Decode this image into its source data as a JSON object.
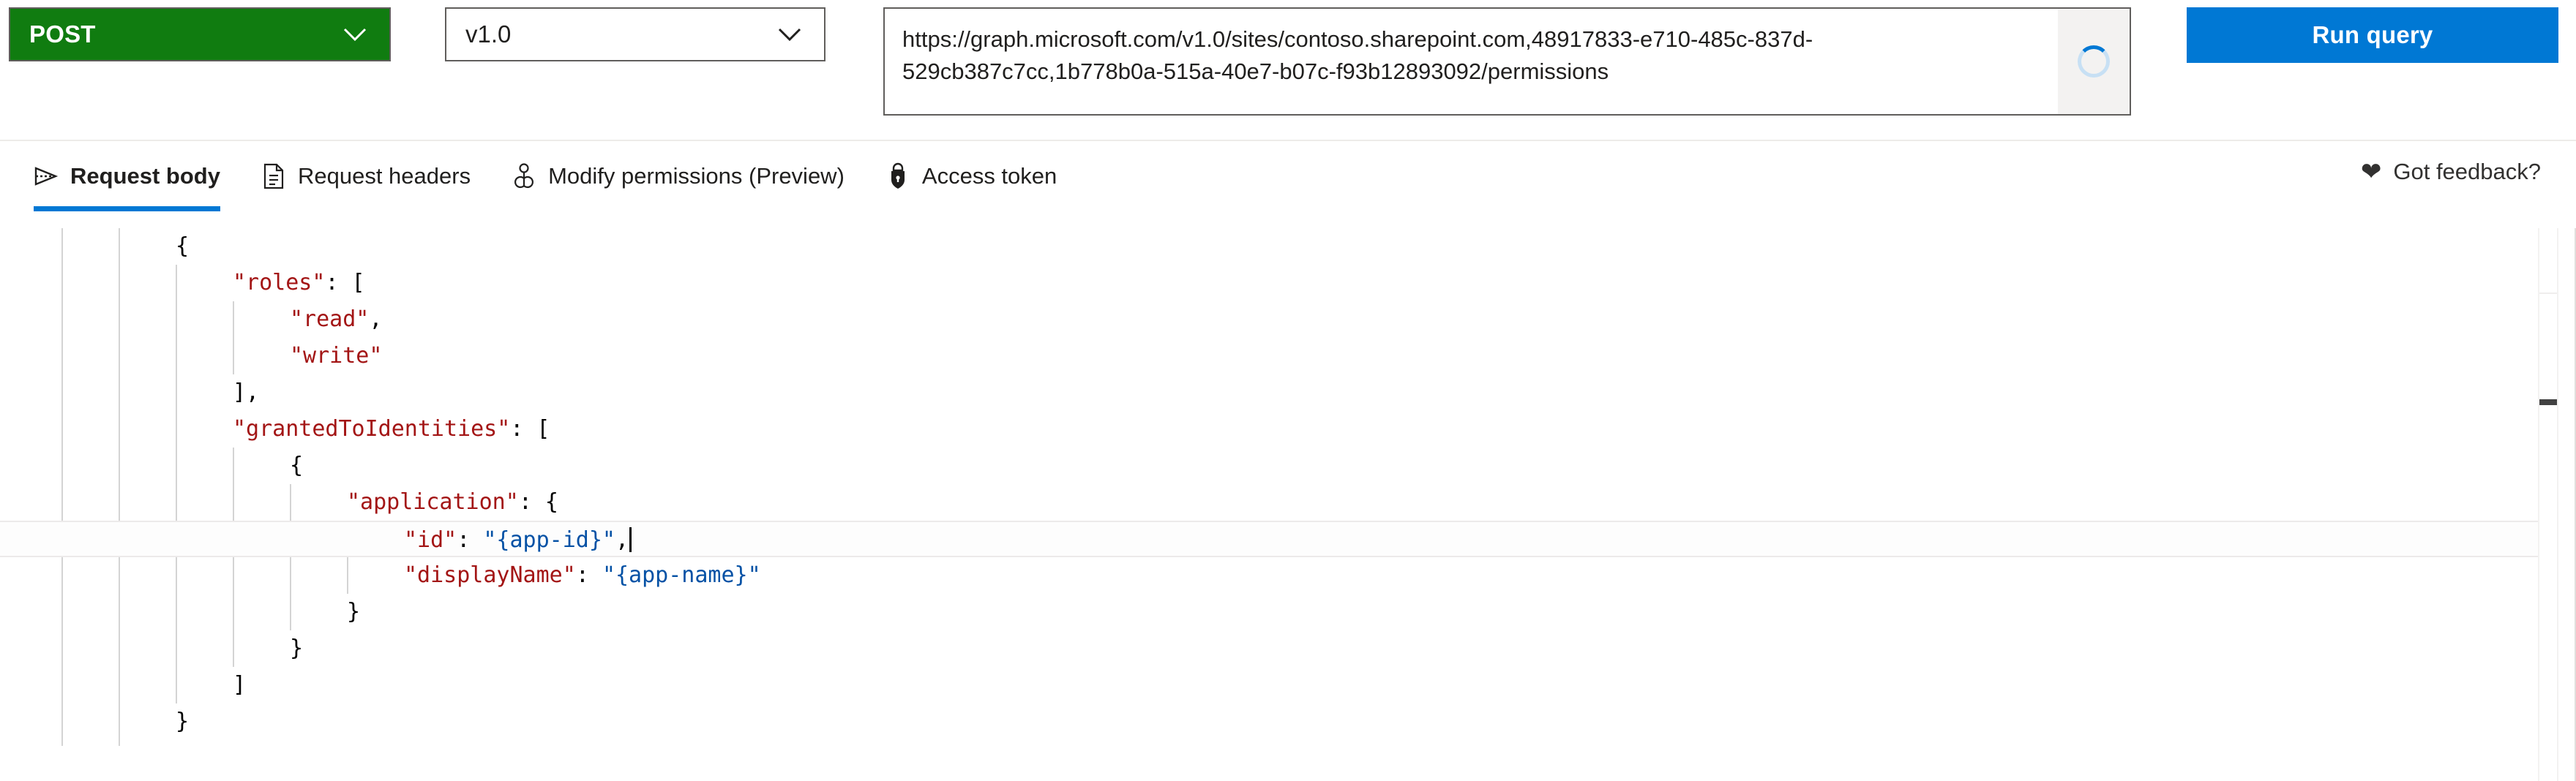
{
  "query_bar": {
    "method": {
      "value": "POST",
      "chevron_icon": "chevron-down-icon",
      "background": "#107c10"
    },
    "version": {
      "value": "v1.0",
      "chevron_icon": "chevron-down-icon"
    },
    "url": {
      "value": "https://graph.microsoft.com/v1.0/sites/contoso.sharepoint.com,48917833-e710-485c-837d-529cb387c7cc,1b778b0a-515a-40e7-b07c-f93b12893092/permissions",
      "loading_icon": "spinner-icon"
    },
    "run_query": {
      "label": "Run query",
      "background": "#0078d4"
    }
  },
  "tabs": {
    "accent_color": "#0078d4",
    "items": [
      {
        "label": "Request body",
        "icon": "send-arrow-icon",
        "active": true
      },
      {
        "label": "Request headers",
        "icon": "document-list-icon",
        "active": false
      },
      {
        "label": "Modify permissions (Preview)",
        "icon": "key-icon",
        "active": false
      },
      {
        "label": "Access token",
        "icon": "lock-shield-icon",
        "active": false
      }
    ],
    "feedback": {
      "label": "Got feedback?",
      "icon": "heart-icon"
    }
  },
  "editor": {
    "language": "json",
    "cursor_line": 7,
    "lines": [
      {
        "indent": 0,
        "tokens": [
          {
            "t": "{",
            "c": "punct"
          }
        ]
      },
      {
        "indent": 1,
        "tokens": [
          {
            "t": "\"roles\"",
            "c": "key"
          },
          {
            "t": ": [",
            "c": "punct"
          }
        ]
      },
      {
        "indent": 2,
        "tokens": [
          {
            "t": "\"read\"",
            "c": "key"
          },
          {
            "t": ",",
            "c": "punct"
          }
        ]
      },
      {
        "indent": 2,
        "tokens": [
          {
            "t": "\"write\"",
            "c": "key"
          }
        ]
      },
      {
        "indent": 1,
        "tokens": [
          {
            "t": "],",
            "c": "punct"
          }
        ]
      },
      {
        "indent": 1,
        "tokens": [
          {
            "t": "\"grantedToIdentities\"",
            "c": "key"
          },
          {
            "t": ": [",
            "c": "punct"
          }
        ]
      },
      {
        "indent": 2,
        "tokens": [
          {
            "t": "{",
            "c": "punct"
          }
        ]
      },
      {
        "indent": 3,
        "tokens": [
          {
            "t": "\"application\"",
            "c": "key"
          },
          {
            "t": ": {",
            "c": "punct"
          }
        ]
      },
      {
        "indent": 4,
        "current": true,
        "tokens": [
          {
            "t": "\"id\"",
            "c": "key"
          },
          {
            "t": ": ",
            "c": "punct"
          },
          {
            "t": "\"{app-id}\"",
            "c": "str"
          },
          {
            "t": ",",
            "c": "punct"
          }
        ]
      },
      {
        "indent": 4,
        "tokens": [
          {
            "t": "\"displayName\"",
            "c": "key"
          },
          {
            "t": ": ",
            "c": "punct"
          },
          {
            "t": "\"{app-name}\"",
            "c": "str"
          }
        ]
      },
      {
        "indent": 3,
        "tokens": [
          {
            "t": "}",
            "c": "punct"
          }
        ]
      },
      {
        "indent": 2,
        "tokens": [
          {
            "t": "}",
            "c": "punct"
          }
        ]
      },
      {
        "indent": 1,
        "tokens": [
          {
            "t": "]",
            "c": "punct"
          }
        ]
      },
      {
        "indent": 0,
        "tokens": [
          {
            "t": "}",
            "c": "punct"
          }
        ]
      }
    ]
  }
}
